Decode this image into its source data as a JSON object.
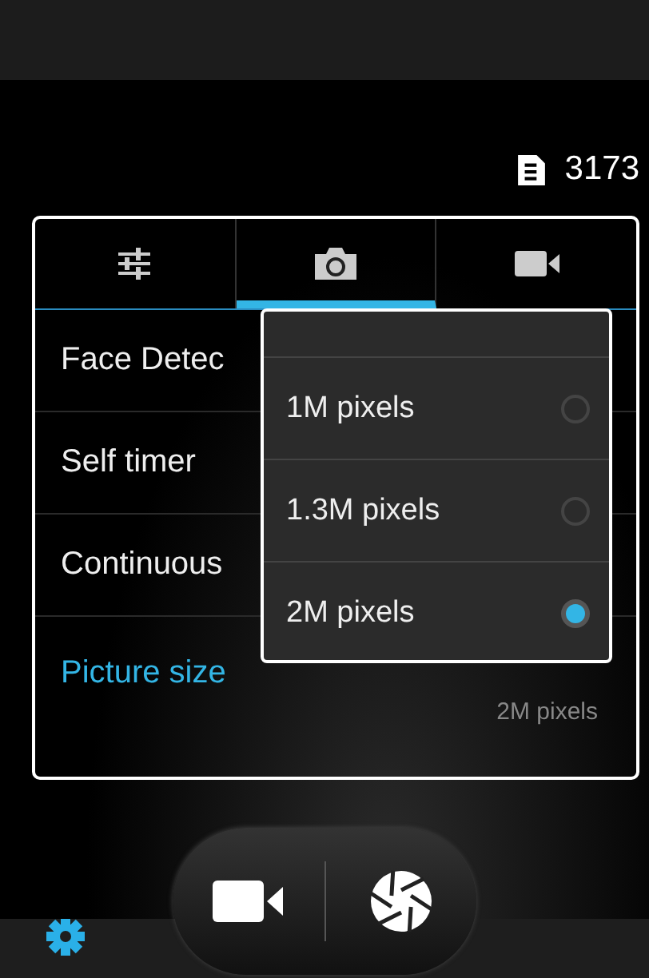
{
  "storage": {
    "count": "3173"
  },
  "tabs": [
    {
      "kind": "settings",
      "selected": false
    },
    {
      "kind": "photo",
      "selected": true
    },
    {
      "kind": "video",
      "selected": false
    }
  ],
  "settings": [
    {
      "label": "Face Detec",
      "selected": false
    },
    {
      "label": "Self timer",
      "selected": false
    },
    {
      "label": "Continuous",
      "selected": false
    },
    {
      "label": "Picture size",
      "selected": true,
      "value": "2M pixels"
    }
  ],
  "popup": {
    "options": [
      {
        "label": "1M pixels",
        "selected": false
      },
      {
        "label": "1.3M pixels",
        "selected": false
      },
      {
        "label": "2M pixels",
        "selected": true
      }
    ]
  }
}
